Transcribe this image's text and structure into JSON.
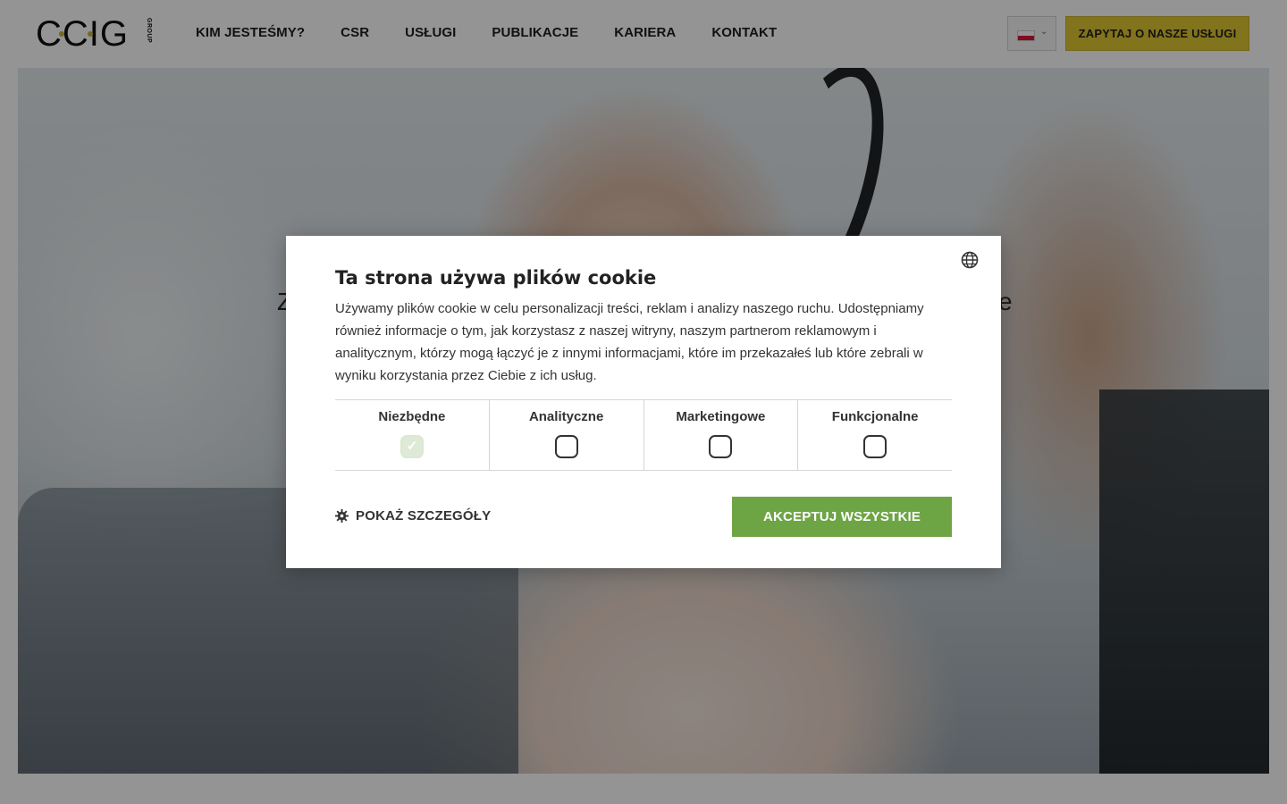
{
  "brand": {
    "logo_text": "CCIG",
    "logo_sub": "GROUP",
    "logo_dot_color": "#c9b33a"
  },
  "nav": {
    "items": [
      {
        "label": "KIM JESTEŚMY?"
      },
      {
        "label": "CSR"
      },
      {
        "label": "USŁUGI"
      },
      {
        "label": "PUBLIKACJE"
      },
      {
        "label": "KARIERA"
      },
      {
        "label": "KONTAKT"
      }
    ],
    "language_flag": "flag-poland-icon",
    "cta_label": "ZAPYTAJ O NASZE USŁUGI",
    "cta_color": "#e1c733"
  },
  "hero": {
    "headline_visible_fragment_left": "Z",
    "headline_visible_fragment_right": "e"
  },
  "cookie_modal": {
    "title": "Ta strona używa plików cookie",
    "description": "Używamy plików cookie w celu personalizacji treści, reklam i analizy naszego ruchu. Udostępniamy również informacje o tym, jak korzystasz z naszej witryny, naszym partnerom reklamowym i analitycznym, którzy mogą łączyć je z innymi informacjami, które im przekazałeś lub które zebrali w wyniku korzystania przez Ciebie z ich usług.",
    "categories": [
      {
        "label": "Niezbędne",
        "checked": true
      },
      {
        "label": "Analityczne",
        "checked": false
      },
      {
        "label": "Marketingowe",
        "checked": false
      },
      {
        "label": "Funkcjonalne",
        "checked": false
      }
    ],
    "details_label": "POKAŻ SZCZEGÓŁY",
    "accept_label": "AKCEPTUJ WSZYSTKIE",
    "accept_color": "#6ea544",
    "language_icon": "globe-icon",
    "details_icon": "gear-icon"
  }
}
